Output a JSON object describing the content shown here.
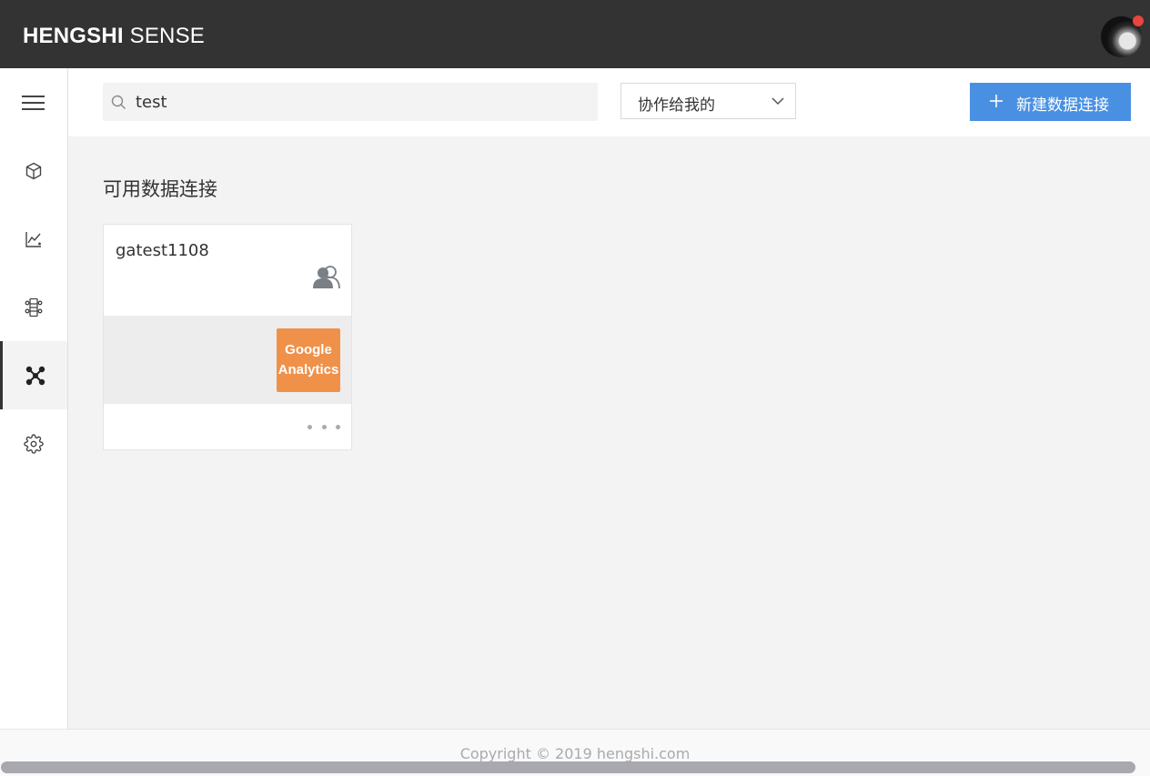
{
  "header": {
    "brand_bold": "HENGSHI",
    "brand_light": "SENSE"
  },
  "sidebar": {
    "items": [
      {
        "name": "menu-icon"
      },
      {
        "name": "cube-icon"
      },
      {
        "name": "chart-icon"
      },
      {
        "name": "dataflow-icon"
      },
      {
        "name": "connection-icon",
        "active": true
      },
      {
        "name": "gear-icon"
      }
    ]
  },
  "toolbar": {
    "search_value": "test",
    "filter_label": "协作给我的",
    "new_button_label": "新建数据连接"
  },
  "main": {
    "section_title": "可用数据连接",
    "cards": [
      {
        "name": "gatest1108",
        "logo_line1": "Google",
        "logo_line2": "Analytics"
      }
    ]
  },
  "footer": {
    "copyright": "Copyright © 2019 hengshi.com"
  },
  "colors": {
    "topbar": "#333333",
    "accent": "#4a90e2",
    "ga_orange": "#f0914a",
    "notify_dot": "#e8453c"
  }
}
